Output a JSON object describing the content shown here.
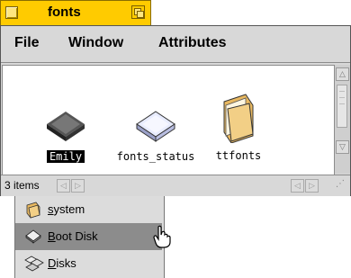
{
  "window": {
    "title": "fonts",
    "menu": [
      "File",
      "Window",
      "Attributes"
    ]
  },
  "icons": [
    {
      "label": "Emily",
      "selected": true,
      "kind": "disk-icon"
    },
    {
      "label": "fonts_status",
      "selected": false,
      "kind": "disk-icon"
    },
    {
      "label": "ttfonts",
      "selected": false,
      "kind": "folder-icon"
    }
  ],
  "status": {
    "count": "3 items"
  },
  "popup": {
    "items": [
      {
        "first": "s",
        "rest": "ystem",
        "icon": "folder-icon"
      },
      {
        "first": "B",
        "rest": "oot Disk",
        "icon": "disk-icon",
        "highlighted": true
      },
      {
        "first": "D",
        "rest": "isks",
        "icon": "disks-icon"
      }
    ]
  },
  "colors": {
    "tab": "#ffcb00",
    "highlight": "#8c8c8c",
    "selection": "#000000"
  }
}
